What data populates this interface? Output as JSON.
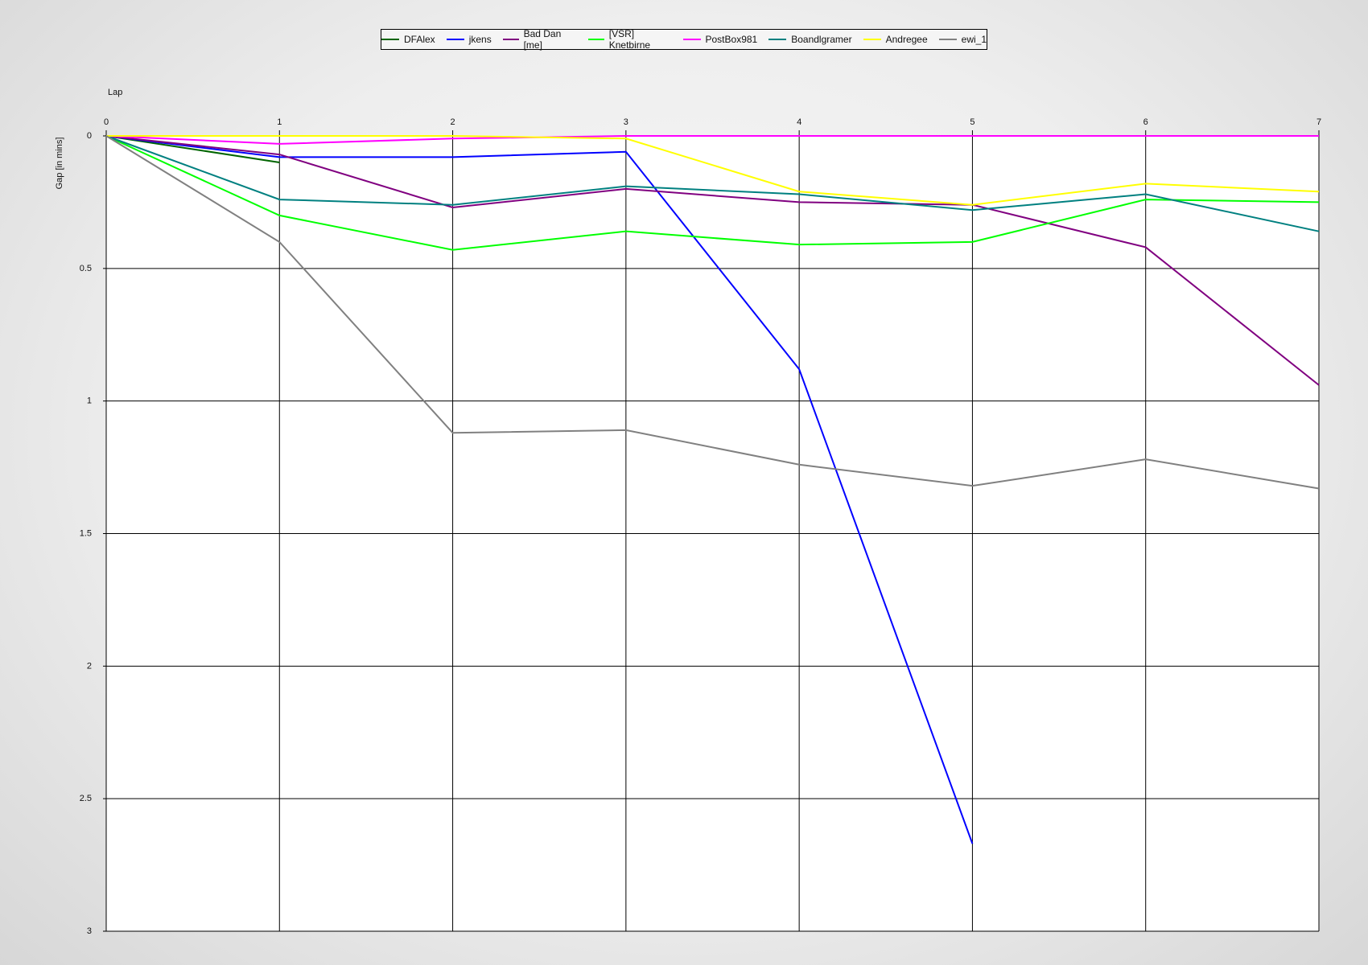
{
  "chart_data": {
    "type": "line",
    "xlabel": "Lap",
    "ylabel": "Gap [in mins]",
    "x": [
      0,
      1,
      2,
      3,
      4,
      5,
      6,
      7
    ],
    "xlim": [
      0,
      7
    ],
    "ylim": [
      0,
      3
    ],
    "y_inverted": true,
    "yticks": [
      "0",
      "0.5",
      "1",
      "1.5",
      "2",
      "2.5",
      "3"
    ],
    "xticks": [
      "0",
      "1",
      "2",
      "3",
      "4",
      "5",
      "6",
      "7"
    ],
    "grid": true,
    "legend_position": "top-center",
    "series": [
      {
        "name": "DFAlex",
        "color": "#006400",
        "values": [
          0,
          0.1
        ]
      },
      {
        "name": "jkens",
        "color": "#0000ff",
        "values": [
          0,
          0.08,
          0.08,
          0.06,
          0.88,
          2.67
        ]
      },
      {
        "name": "Bad Dan [me]",
        "color": "#800080",
        "values": [
          0,
          0.07,
          0.27,
          0.2,
          0.25,
          0.26,
          0.42,
          0.94
        ]
      },
      {
        "name": "[VSR] Knetbirne",
        "color": "#00ff00",
        "values": [
          0,
          0.3,
          0.43,
          0.36,
          0.41,
          0.4,
          0.24,
          0.25
        ]
      },
      {
        "name": "PostBox981",
        "color": "#ff00ff",
        "values": [
          0,
          0.03,
          0.01,
          0,
          0,
          0,
          0,
          0
        ]
      },
      {
        "name": "Boandlgramer",
        "color": "#008080",
        "values": [
          0,
          0.24,
          0.26,
          0.19,
          0.22,
          0.28,
          0.22,
          0.36
        ]
      },
      {
        "name": "Andregee",
        "color": "#ffff00",
        "values": [
          0,
          0,
          0,
          0.01,
          0.21,
          0.26,
          0.18,
          0.21
        ]
      },
      {
        "name": "ewi_1",
        "color": "#808080",
        "values": [
          0,
          0.4,
          1.12,
          1.11,
          1.24,
          1.32,
          1.22,
          1.33
        ]
      }
    ]
  }
}
